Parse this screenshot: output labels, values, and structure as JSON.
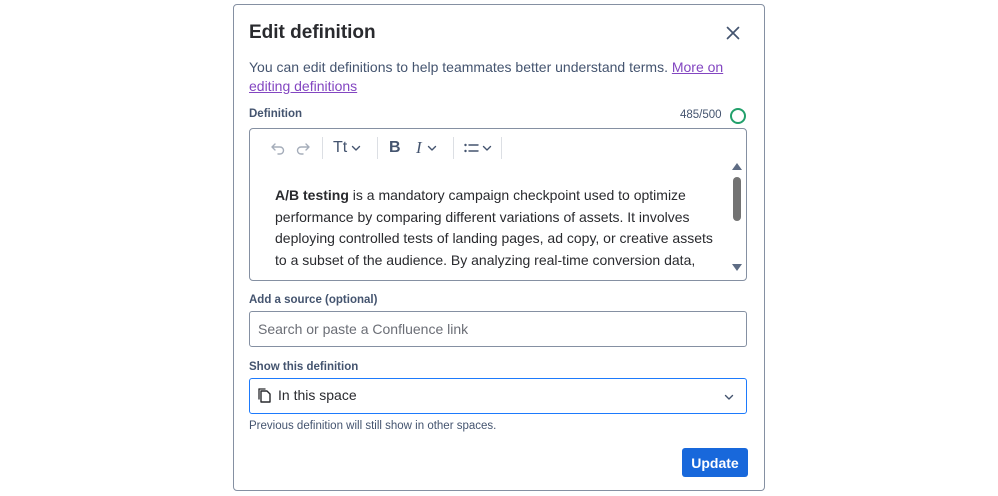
{
  "dialog": {
    "title": "Edit definition",
    "description": "You can edit definitions to help teammates better understand terms.",
    "link_text": "More on editing definitions"
  },
  "definition": {
    "label": "Definition",
    "counter": "485/500",
    "term": "A/B testing",
    "text": " is a mandatory campaign checkpoint used to optimize performance by comparing different variations of assets. It involves deploying controlled tests of landing pages, ad copy, or creative assets to a subset of the audience. By analyzing real-time conversion data,",
    "toolbar": {
      "text_style_label": "Tt",
      "bold_label": "B",
      "italic_label": "I"
    }
  },
  "source": {
    "label": "Add a source (optional)",
    "placeholder": "Search or paste a Confluence link",
    "value": ""
  },
  "visibility": {
    "label": "Show this definition",
    "selected": "In this space",
    "hint": "Previous definition will still show in other spaces."
  },
  "actions": {
    "update_label": "Update"
  },
  "colors": {
    "primary": "#1868db",
    "link": "#8346c1",
    "counter_ring": "#22a06b",
    "focus_border": "#1d7afc"
  },
  "icons": [
    "close-icon",
    "undo-icon",
    "redo-icon",
    "chevron-down-icon",
    "list-icon",
    "page-icon"
  ]
}
